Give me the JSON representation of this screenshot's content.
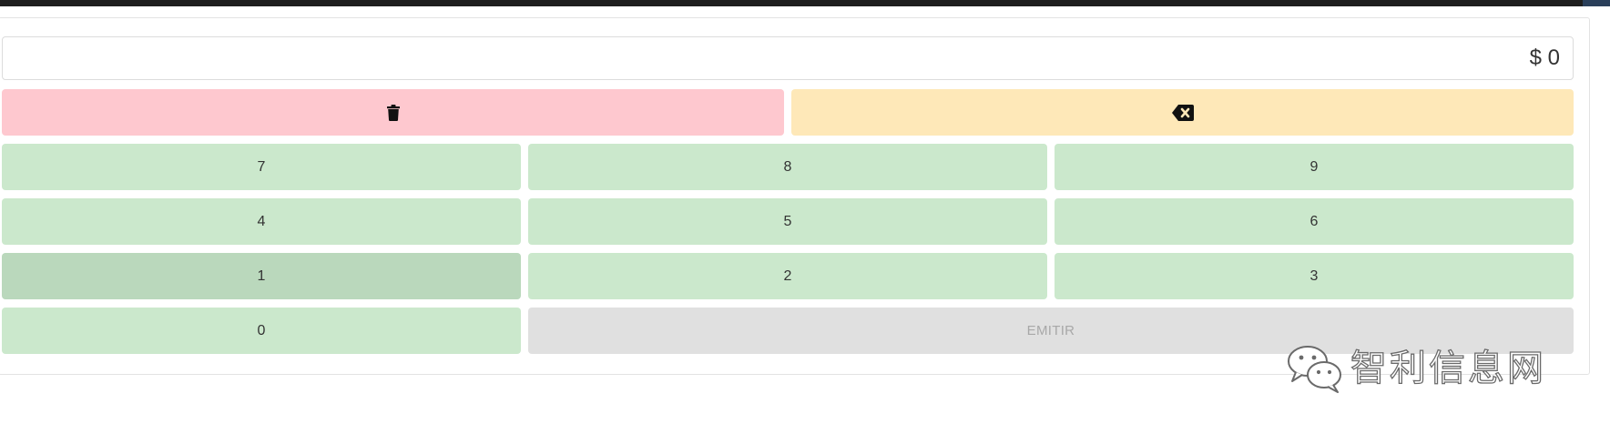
{
  "display": {
    "amount": "$ 0"
  },
  "actions": {
    "clear_icon": "trash-icon",
    "backspace_icon": "backspace-icon"
  },
  "keypad": {
    "k7": "7",
    "k8": "8",
    "k9": "9",
    "k4": "4",
    "k5": "5",
    "k6": "6",
    "k1": "1",
    "k2": "2",
    "k3": "3",
    "k0": "0",
    "emit_label": "EMITIR"
  },
  "watermark": {
    "text": "智利信息网",
    "icon": "wechat-icon"
  },
  "colors": {
    "clear_bg": "#fec8cf",
    "backspace_bg": "#fee8b8",
    "digit_bg": "#cbe8cc",
    "digit_pressed_bg": "#bad8bc",
    "emit_bg": "#e0e0e0",
    "emit_text": "#a8a8a8"
  }
}
